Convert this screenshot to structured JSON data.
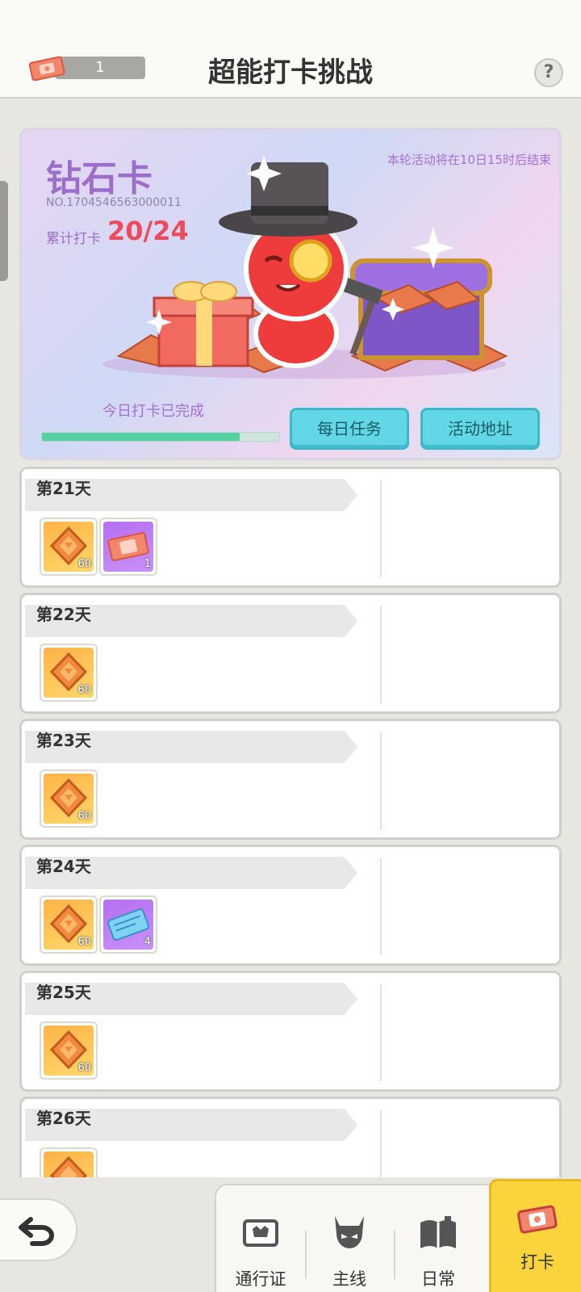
{
  "header": {
    "title": "超能打卡挑战",
    "ticket_count": "1",
    "help_label": "?"
  },
  "banner": {
    "card_name": "钻石卡",
    "card_no": "NO.1704546563000011",
    "checkin_label": "累计打卡",
    "checkin_value": "20/24",
    "checkin_progress": 0.8333,
    "countdown": "本轮活动将在10日15时后结束",
    "today_status": "今日打卡已完成",
    "daily_task_button": "每日任务",
    "activity_address_button": "活动地址"
  },
  "days": [
    {
      "label": "第21天",
      "rewards": [
        {
          "type": "gold",
          "qty": "60"
        },
        {
          "type": "ticket",
          "qty": "1"
        }
      ]
    },
    {
      "label": "第22天",
      "rewards": [
        {
          "type": "gold",
          "qty": "60"
        }
      ]
    },
    {
      "label": "第23天",
      "rewards": [
        {
          "type": "gold",
          "qty": "60"
        }
      ]
    },
    {
      "label": "第24天",
      "rewards": [
        {
          "type": "gold",
          "qty": "60"
        },
        {
          "type": "pass",
          "qty": "4"
        }
      ]
    },
    {
      "label": "第25天",
      "rewards": [
        {
          "type": "gold",
          "qty": "60"
        }
      ]
    },
    {
      "label": "第26天",
      "rewards": [
        {
          "type": "gold",
          "qty": ""
        }
      ]
    }
  ],
  "nav": {
    "pass": "通行证",
    "main": "主线",
    "daily": "日常",
    "checkin": "打卡"
  }
}
